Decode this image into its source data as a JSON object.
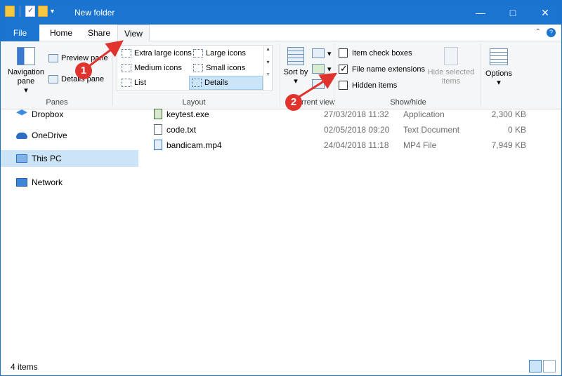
{
  "window": {
    "title": "New folder",
    "accent": "#1a74d0",
    "controls": [
      "—",
      "□",
      "✕"
    ]
  },
  "qat": {
    "down_glyph": "▾"
  },
  "ribbon_tabs": {
    "file": "File",
    "home": "Home",
    "share": "Share",
    "view": "View",
    "help_glyph": "?",
    "collapse_glyph": "⌃"
  },
  "ribbon": {
    "panes": {
      "label": "Panes",
      "navigation_pane": "Navigation pane",
      "navigation_pane_arrow": "▾",
      "preview_pane": "Preview pane",
      "details_pane": "Details pane"
    },
    "layout": {
      "label": "Layout",
      "items": [
        {
          "label": "Extra large icons",
          "selected": false
        },
        {
          "label": "Large icons",
          "selected": false
        },
        {
          "label": "Medium icons",
          "selected": false
        },
        {
          "label": "Small icons",
          "selected": false
        },
        {
          "label": "List",
          "selected": false
        },
        {
          "label": "Details",
          "selected": true
        }
      ],
      "scroll_glyphs": [
        "▴",
        "▾",
        "▿"
      ]
    },
    "current_view": {
      "label": "Current view",
      "sort_by": "Sort by",
      "arrow": "▾"
    },
    "show_hide": {
      "label": "Show/hide",
      "item_check_boxes": {
        "label": "Item check boxes",
        "checked": false
      },
      "file_name_extensions": {
        "label": "File name extensions",
        "checked": true
      },
      "hidden_items": {
        "label": "Hidden items",
        "checked": false
      },
      "hide_selected": "Hide selected items"
    },
    "options": {
      "label": "Options",
      "arrow": "▾"
    }
  },
  "nav_pane": {
    "items": [
      {
        "label": "Dropbox",
        "icon": "dropbox-icon",
        "selected": false
      },
      {
        "label": "OneDrive",
        "icon": "onedrive-icon",
        "selected": false
      },
      {
        "label": "This PC",
        "icon": "this-pc-icon",
        "selected": true
      },
      {
        "label": "Network",
        "icon": "network-icon",
        "selected": false
      }
    ]
  },
  "files": [
    {
      "name": "keytest.exe",
      "date": "27/03/2018 11:32",
      "type": "Application",
      "size": "2,300 KB",
      "icon": "exe-file-icon"
    },
    {
      "name": "code.txt",
      "date": "02/05/2018 09:20",
      "type": "Text Document",
      "size": "0 KB",
      "icon": "text-file-icon"
    },
    {
      "name": "bandicam.mp4",
      "date": "24/04/2018 11:18",
      "type": "MP4 File",
      "size": "7,949 KB",
      "icon": "video-file-icon"
    }
  ],
  "status": {
    "items_count": "4 items"
  },
  "annotations": {
    "color": "#e0332e",
    "markers": [
      {
        "number": "1"
      },
      {
        "number": "2"
      }
    ]
  }
}
